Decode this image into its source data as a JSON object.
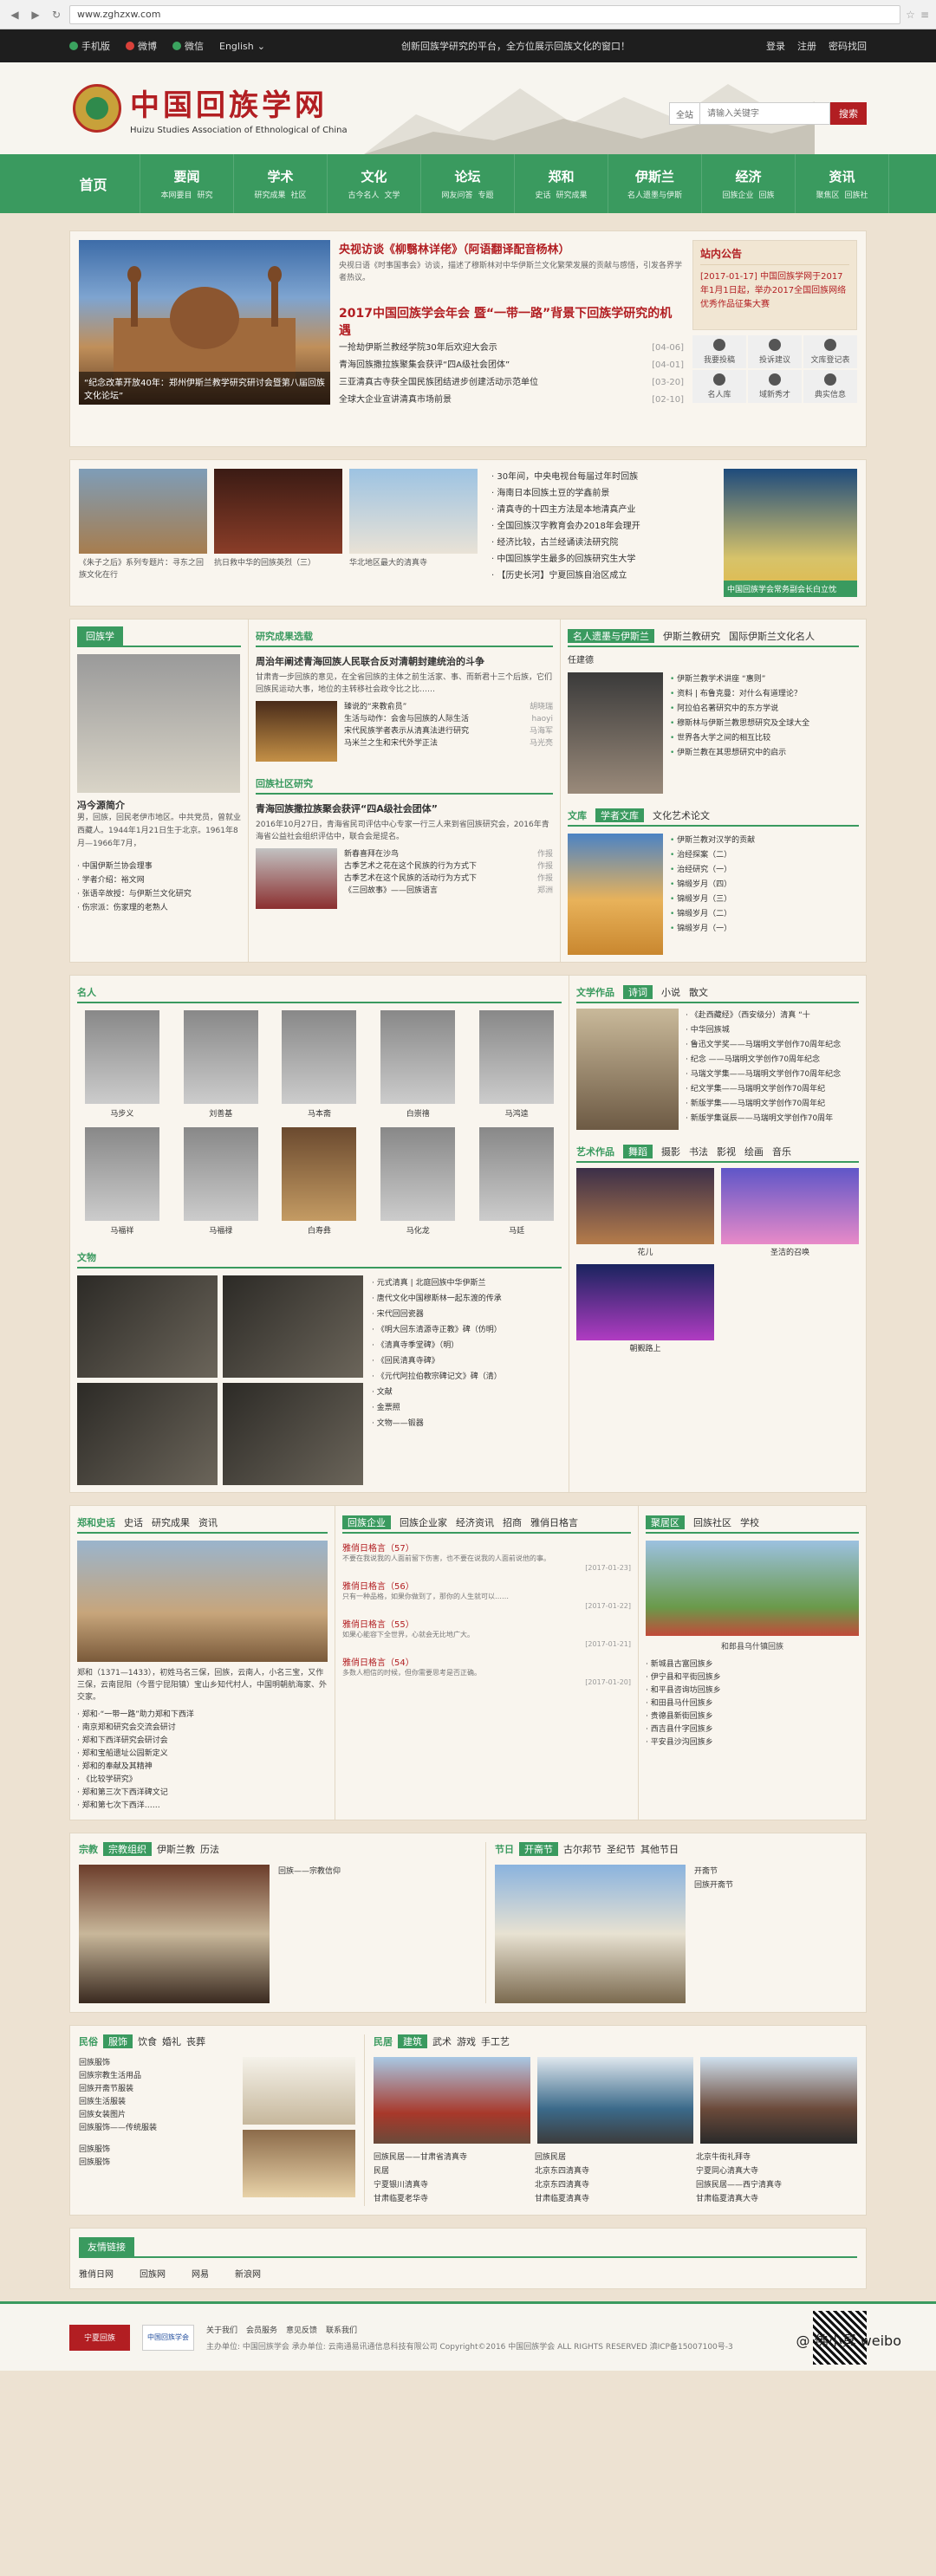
{
  "browser": {
    "url": "www.zghzxw.com"
  },
  "topbar": {
    "items": [
      "手机版",
      "微博",
      "微信",
      "English"
    ],
    "slogan": "创新回族学研究的平台，全方位展示回族文化的窗口！",
    "right": [
      "登录",
      "注册",
      "密码找回"
    ]
  },
  "header": {
    "name": "中国回族学网",
    "en": "Huizu Studies Association of Ethnological of China",
    "search_sel": "全站",
    "search_ph": "请输入关键字",
    "search_btn": "搜索"
  },
  "nav": [
    {
      "main": "首页",
      "subs": []
    },
    {
      "main": "要闻",
      "subs": [
        "本网要目",
        "研究"
      ]
    },
    {
      "main": "学术",
      "subs": [
        "研究成果",
        "社区"
      ]
    },
    {
      "main": "文化",
      "subs": [
        "古今名人",
        "文学"
      ]
    },
    {
      "main": "论坛",
      "subs": [
        "网友问答",
        "专题"
      ]
    },
    {
      "main": "郑和",
      "subs": [
        "史话",
        "研究成果"
      ]
    },
    {
      "main": "伊斯兰",
      "subs": [
        "名人遗墨与伊斯"
      ]
    },
    {
      "main": "经济",
      "subs": [
        "回族企业",
        "回族"
      ]
    },
    {
      "main": "资讯",
      "subs": [
        "聚焦区",
        "回族社"
      ]
    }
  ],
  "feature": {
    "caption": "“纪念改革开放40年：郑州伊斯兰教学研究研讨会暨第八届回族文化论坛”",
    "h1": "央视访谈《柳翳林详佬》（阿语翻译配音杨林）",
    "h1s": "央视日语《时事国事会》访谈，描述了穆斯林对中华伊斯兰文化繁荣发展的贡献与感悟，引发各界学者热议。",
    "h2": "2017中国回族学会年会 暨“一带一路”背景下回族学研究的机遇",
    "news": [
      {
        "t": "一抢劫伊斯兰教经学院30年后欢迎大会示",
        "d": "[04-06]"
      },
      {
        "t": "青海回族撒拉族聚集会获评“四A级社会团体”",
        "d": "[04-01]"
      },
      {
        "t": "三亚清真古寺获全国民族团结进步创建活动示范单位",
        "d": "[03-20]"
      },
      {
        "t": "全球大企业宣讲清真市场前景",
        "d": "[02-10]"
      }
    ],
    "notice_title": "站内公告",
    "notice": "[2017-01-17] 中国回族学网于2017年1月1日起，举办2017全国回族网络优秀作品征集大赛",
    "quick": [
      "我要投稿",
      "投诉建议",
      "文库登记表",
      "名人库",
      "域新秀才",
      "典实信息"
    ]
  },
  "gallery": {
    "items": [
      "《朱子之后》系列专题片：寻东之回族文化在行",
      "抗日救中华的回族英烈（三）",
      "华北地区最大的清真寺"
    ],
    "list": [
      "30年间，中央电视台每届过年时回族",
      "海南日本回族土豆的学鑫前景",
      "清真寺的十四主方法是本地清真产业",
      "全国回族汉字教育会办2018年会理开",
      "经济比较，古兰经诵读法研究院",
      "中国回族学生最多的回族研究生大学",
      "【历史长河】宁夏回族自治区成立"
    ],
    "big_caption": "中国回族学会常务副会长白立忱"
  },
  "huizu": {
    "tag": "回族学",
    "name": "冯今源简介",
    "bio": "男，回族，回民老伊市地区。中共党员，曾就业西藏人。1944年1月21日生于北京。1961年8月—1966年7月，",
    "list": [
      "中国伊斯兰协会理事",
      "学者介绍：裕文网",
      "张语辛故授：与伊斯兰文化研究",
      "伤宗派：伤家理的老熟人"
    ]
  },
  "research": {
    "title": "研究成果选载",
    "sub": "回族社区研究",
    "h": "周治年阐述青海回族人民联合反对清朝封建统治的斗争",
    "s": "甘肃青一步回族的意见，在全省回族的主体之前生活家、事、而新君十三个后族，它们回族民运动大事，地位的主转移社会政令比之比……",
    "list1": [
      {
        "t": "臻说的“来教俞员”",
        "a": "胡晓瑞"
      },
      {
        "t": "生活与动作：会舍与回族的人际生活",
        "a": "haoyi"
      },
      {
        "t": "宋代民族学者表示从清真法进行研究",
        "a": "马海军"
      },
      {
        "t": "马米兰之生和宋代外学正法",
        "a": "马光亮"
      }
    ],
    "h2": "青海回族撒拉族聚会获评“四A级社会团体”",
    "s2": "2016年10月27日，青海省民司评估中心专家一行三人来到省回族研究会，2016年青海省公益社会组织评估中，联合会是提名。",
    "list2": [
      {
        "t": "新春喜拜在沙鸟",
        "a": "作报"
      },
      {
        "t": "古季艺术之花在这个民族的行为方式下",
        "a": "作报"
      },
      {
        "t": "古季艺术在这个民族的活动行为方式下",
        "a": "作报"
      },
      {
        "t": "《三回故事》——回族语言",
        "a": "郑洲"
      }
    ]
  },
  "mingren": {
    "tabs": [
      "名人遗墨与伊斯兰",
      "伊斯兰教研究",
      "国际伊斯兰文化名人"
    ],
    "name": "任建德",
    "list": [
      "伊斯兰教学术讲座 “惠则”",
      "资料 | 布鲁克曼：对什么有道理论？",
      "阿拉伯名著研究中的东方学说",
      "穆斯林与伊斯兰教思想研究及全球大全",
      "世界各大学之间的相互比较",
      "伊斯兰教在其思想研究中的启示"
    ]
  },
  "wenku": {
    "tag": "文库",
    "on": "学者文库",
    "sub": "文化艺术论文",
    "list": [
      "伊斯兰教对汉学的贡献",
      "治经探案（二）",
      "治经研究（一）",
      "锦缎岁月（四）",
      "锦缎岁月（三）",
      "锦缎岁月（二）",
      "锦缎岁月（一）"
    ]
  },
  "people": {
    "title": "名人",
    "names": [
      "马步义",
      "刘善基",
      "马本斋",
      "白崇禧",
      "马鸿逵",
      "马福祥",
      "马福禄",
      "白寿彝",
      "马化龙",
      "马廷"
    ]
  },
  "wenwu": {
    "title": "文物",
    "list": [
      "元式清真 | 北庭回族中华伊斯兰",
      "唐代文化中国穆斯林一起东渡的传承",
      "宋代回回瓷器",
      "《明大回东清源寺正教》碑（仿明）",
      "《清真寺季堂碑》（明）",
      "《回民清真寺碑》",
      "《元代阿拉伯教宗碑记文》碑（清）",
      "文献",
      "金票照",
      "文物——锻器"
    ]
  },
  "literature": {
    "title": "文学作品",
    "tabs": [
      "诗词",
      "小说",
      "散文"
    ],
    "list": [
      "《赴西藏经》（西安级分）清真 “十",
      "中华回族城",
      "鲁迅文学奖——马瑞明文学创作70周年纪念",
      "纪念 ——马瑞明文学创作70周年纪念",
      "马瑞文学集——马瑞明文学创作70周年纪念",
      "纪文学集——马瑞明文学创作70周年纪",
      "新版学集——马瑞明文学创作70周年纪",
      "新版学集诞辰——马瑞明文学创作70周年"
    ]
  },
  "artworks": {
    "title": "艺术作品",
    "tabs": [
      "舞蹈",
      "摄影",
      "书法",
      "影视",
      "绘画",
      "音乐"
    ],
    "items": [
      "花儿",
      "圣洁的召唤",
      "朝觐路上"
    ]
  },
  "zhenghe": {
    "title": "郑和史话",
    "tabs": [
      "史话",
      "研究成果",
      "资讯"
    ],
    "p": "郑和（1371—1433），初姓马名三保，回族，云南人，小名三宝，又作三保，云南昆阳（今晋宁昆阳镇）宝山乡知代村人，中国明朝航海家、外交家。",
    "list": [
      "郑和·“一带一路”助力郑和下西洋",
      "南京郑和研究会交流会研讨",
      "郑和下西洋研究会研讨会",
      "郑和宝船遗址公园新定义",
      "郑和的奉献及其精神",
      "《比较学研究》",
      "郑和第三次下西洋碑文记",
      "郑和第七次下西洋……"
    ]
  },
  "enterprise": {
    "title": "回族企业",
    "tabs": [
      "回族企业家",
      "经济资讯",
      "招商",
      "雅俏日格言"
    ],
    "items": [
      {
        "t": "雅俏日格言（57）",
        "s": "不要在我说我的人面前留下伤害，也不要在说我的人面前说他的事。",
        "d": "[2017-01-23]"
      },
      {
        "t": "雅俏日格言（56）",
        "s": "只有一种品格，如果你做到了，那你的人生就可以……",
        "d": "[2017-01-22]"
      },
      {
        "t": "雅俏日格言（55）",
        "s": "如果心能容下全世界，心就会无比地广大。",
        "d": "[2017-01-21]"
      },
      {
        "t": "雅俏日格言（54）",
        "s": "多数人相信的时候，但你需要思考是否正确。",
        "d": "[2017-01-20]"
      }
    ]
  },
  "juji": {
    "title": "聚居区",
    "tabs": [
      "回族社区",
      "学校"
    ],
    "caption": "和郎县乌什镇回族",
    "list": [
      "新城县古富回族乡",
      "伊宁县和平街回族乡",
      "和平县咨询坊回族乡",
      "和田县马什回族乡",
      "贵德县新街回族乡",
      "西吉县什字回族乡",
      "平安县沙沟回族乡"
    ]
  },
  "religion": {
    "title": "宗教",
    "tabs": [
      "宗教组织",
      "伊斯兰教",
      "历法"
    ],
    "list": [
      "回族——宗教信仰"
    ]
  },
  "festival": {
    "title": "节日",
    "tabs": [
      "开斋节",
      "古尔邦节",
      "圣纪节",
      "其他节日"
    ],
    "list": [
      "开斋节",
      "回族开斋节"
    ]
  },
  "custom": {
    "title": "民俗",
    "tabs": [
      "服饰",
      "饮食",
      "婚礼",
      "丧葬"
    ],
    "list": [
      "回族服饰",
      "回族宗教生活用品",
      "回族开斋节服装",
      "回族生活服装",
      "回族女装图片",
      "回族服饰——传统服装"
    ],
    "extra": [
      "回族服饰",
      "回族服饰"
    ]
  },
  "architecture": {
    "title": "民居",
    "tabs": [
      "建筑",
      "武术",
      "游戏",
      "手工艺"
    ],
    "list": [
      "回族民居——甘肃省清真寺",
      "回族民居",
      "北京牛街礼拜寺",
      "民居",
      "北京东四清真寺",
      "宁夏同心清真大寺",
      "宁夏银川清真寺",
      "北京东四清真寺",
      "回族民居——西宁清真寺",
      "甘肃临夏老华寺",
      "甘肃临夏清真寺",
      "甘肃临夏清真大寺"
    ]
  },
  "links": {
    "title": "友情链接",
    "items": [
      "雅俏日网",
      "回族网",
      "网易",
      "新浪网"
    ]
  },
  "footer": {
    "logo1": "宁夏回族",
    "logo2": "中国回族学会",
    "links": [
      "关于我们",
      "会员服务",
      "意见反馈",
      "联系我们"
    ],
    "lines": [
      "主办单位: 中国回族学会  承办单位: 云南通易讯通信息科技有限公司  Copyright©2016 中国回族学会 ALL RIGHTS RESERVED  滇ICP备15007100号-3"
    ],
    "wm": "@ 佛小冥 weibo"
  }
}
